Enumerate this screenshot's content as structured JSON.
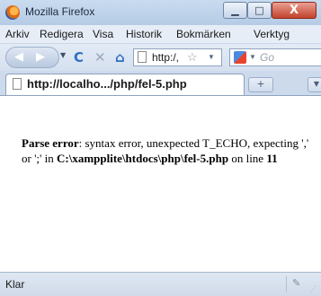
{
  "window": {
    "title": "Mozilla Firefox",
    "minimize_glyph": "▁",
    "maximize_glyph": "□",
    "close_glyph": "X"
  },
  "menu": {
    "items": [
      "Arkiv",
      "Redigera",
      "Visa",
      "Historik",
      "Bokmärken",
      "Verktyg"
    ]
  },
  "toolbar": {
    "back_glyph": "◀",
    "forward_glyph": "▶",
    "dropdown_glyph": "▼",
    "reload_glyph": "C",
    "stop_glyph": "✕",
    "home_glyph": "⌂",
    "url": "http:/,",
    "star_glyph": "☆",
    "search_placeholder": "Go"
  },
  "tabs": [
    {
      "label": "http://localho.../php/fel-5.php"
    }
  ],
  "tabstrip": {
    "newtab_glyph": "+",
    "list_glyph": "▼"
  },
  "content": {
    "error_label": "Parse error",
    "error_text": ": syntax error, unexpected T_ECHO, expecting ',' or ';' in ",
    "error_path": "C:\\xampplite\\htdocs\\php\\fel-5.php",
    "error_line_prefix": " on line ",
    "error_line": "11"
  },
  "status": {
    "text": "Klar",
    "icon_glyph": "✎",
    "grip_glyph": "⋰"
  },
  "colors": {
    "titlebar": "#c9dbef",
    "close_button": "#c2432d",
    "reload_icon": "#2e6fc2"
  }
}
